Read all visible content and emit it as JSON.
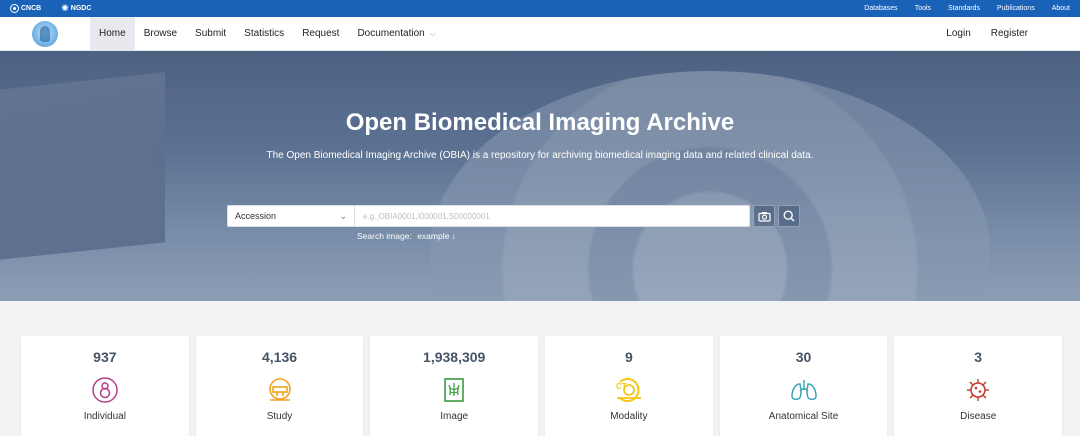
{
  "topbar": {
    "brands": [
      {
        "name": "CNCB"
      },
      {
        "name": "NGDC"
      }
    ],
    "links": [
      "Databases",
      "Tools",
      "Standards",
      "Publications",
      "About"
    ]
  },
  "nav": {
    "items": [
      {
        "label": "Home",
        "active": true
      },
      {
        "label": "Browse"
      },
      {
        "label": "Submit"
      },
      {
        "label": "Statistics"
      },
      {
        "label": "Request"
      },
      {
        "label": "Documentation",
        "dropdown": true
      }
    ],
    "login": "Login",
    "register": "Register"
  },
  "hero": {
    "title": "Open Biomedical Imaging Archive",
    "subtitle": "The Open Biomedical Imaging Archive (OBIA) is a repository for archiving biomedical imaging data and related clinical data.",
    "search": {
      "select_value": "Accession",
      "placeholder": "e.g.,OBIA0001,I000001,S00000001",
      "hint": "Search image:",
      "hint_link": "example ↓"
    }
  },
  "stats": [
    {
      "value": "937",
      "label": "Individual",
      "icon": "individual-icon",
      "color": "#b3418a"
    },
    {
      "value": "4,136",
      "label": "Study",
      "icon": "study-icon",
      "color": "#f0a21f"
    },
    {
      "value": "1,938,309",
      "label": "Image",
      "icon": "image-icon",
      "color": "#3d9a43"
    },
    {
      "value": "9",
      "label": "Modality",
      "icon": "modality-icon",
      "color": "#f5c518"
    },
    {
      "value": "30",
      "label": "Anatomical Site",
      "icon": "lungs-icon",
      "color": "#3aa6b9"
    },
    {
      "value": "3",
      "label": "Disease",
      "icon": "virus-icon",
      "color": "#c0392b"
    }
  ]
}
